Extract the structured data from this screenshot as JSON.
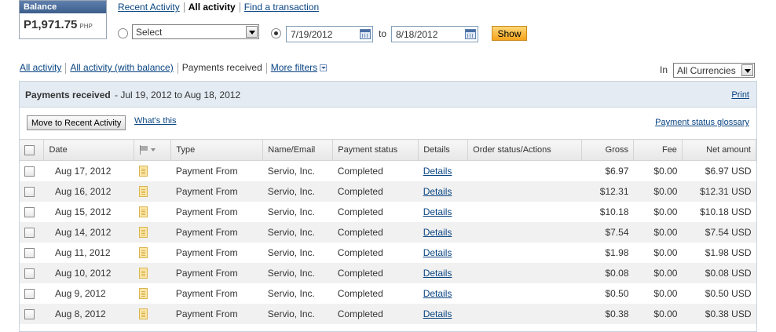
{
  "balance": {
    "label": "Balance",
    "amount": "P1,971.75",
    "currency": "PHP"
  },
  "top_tabs": {
    "recent": "Recent Activity",
    "all": "All activity",
    "find": "Find a transaction"
  },
  "filters": {
    "select_value": "Select",
    "from_date": "7/19/2012",
    "to_label": "to",
    "to_date": "8/18/2012",
    "show_label": "Show"
  },
  "sub_tabs": {
    "all": "All activity",
    "all_balance": "All activity (with balance)",
    "payments": "Payments received",
    "more": "More filters"
  },
  "currency": {
    "in_label": "In",
    "value": "All Currencies"
  },
  "panel": {
    "title": "Payments received",
    "range": "- Jul 19, 2012 to Aug 18, 2012",
    "print": "Print",
    "move_button": "Move to Recent Activity",
    "whats_this": "What's this",
    "glossary": "Payment status glossary"
  },
  "table": {
    "headers": {
      "date": "Date",
      "type": "Type",
      "name": "Name/Email",
      "status": "Payment status",
      "details": "Details",
      "order": "Order status/Actions",
      "gross": "Gross",
      "fee": "Fee",
      "net": "Net amount"
    },
    "rows": [
      {
        "date": "Aug 17, 2012",
        "type": "Payment From",
        "name": "Servio, Inc.",
        "status": "Completed",
        "details": "Details",
        "gross": "$6.97",
        "fee": "$0.00",
        "net": "$6.97 USD"
      },
      {
        "date": "Aug 16, 2012",
        "type": "Payment From",
        "name": "Servio, Inc.",
        "status": "Completed",
        "details": "Details",
        "gross": "$12.31",
        "fee": "$0.00",
        "net": "$12.31 USD"
      },
      {
        "date": "Aug 15, 2012",
        "type": "Payment From",
        "name": "Servio, Inc.",
        "status": "Completed",
        "details": "Details",
        "gross": "$10.18",
        "fee": "$0.00",
        "net": "$10.18 USD"
      },
      {
        "date": "Aug 14, 2012",
        "type": "Payment From",
        "name": "Servio, Inc.",
        "status": "Completed",
        "details": "Details",
        "gross": "$7.54",
        "fee": "$0.00",
        "net": "$7.54 USD"
      },
      {
        "date": "Aug 11, 2012",
        "type": "Payment From",
        "name": "Servio, Inc.",
        "status": "Completed",
        "details": "Details",
        "gross": "$1.98",
        "fee": "$0.00",
        "net": "$1.98 USD"
      },
      {
        "date": "Aug 10, 2012",
        "type": "Payment From",
        "name": "Servio, Inc.",
        "status": "Completed",
        "details": "Details",
        "gross": "$0.08",
        "fee": "$0.00",
        "net": "$0.08 USD"
      },
      {
        "date": "Aug 9, 2012",
        "type": "Payment From",
        "name": "Servio, Inc.",
        "status": "Completed",
        "details": "Details",
        "gross": "$0.50",
        "fee": "$0.00",
        "net": "$0.50 USD"
      },
      {
        "date": "Aug 8, 2012",
        "type": "Payment From",
        "name": "Servio, Inc.",
        "status": "Completed",
        "details": "Details",
        "gross": "$0.38",
        "fee": "$0.00",
        "net": "$0.38 USD"
      }
    ]
  }
}
